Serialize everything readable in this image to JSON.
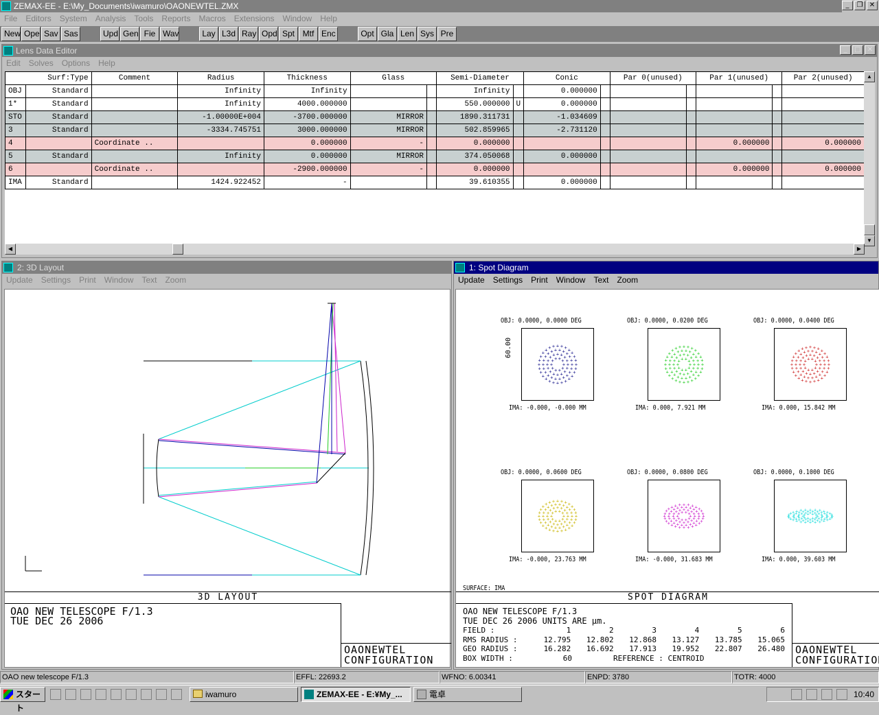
{
  "app": {
    "title": "ZEMAX-EE - E:\\My_Documents\\iwamuro\\OAONEWTEL.ZMX"
  },
  "menu": [
    "File",
    "Editors",
    "System",
    "Analysis",
    "Tools",
    "Reports",
    "Macros",
    "Extensions",
    "Window",
    "Help"
  ],
  "toolbar": {
    "group1": [
      "New",
      "Ope",
      "Sav",
      "Sas"
    ],
    "group2": [
      "Upd",
      "Gen",
      "Fie",
      "Wav"
    ],
    "group3": [
      "Lay",
      "L3d",
      "Ray",
      "Opd",
      "Spt",
      "Mtf",
      "Enc"
    ],
    "group4": [
      "Opt",
      "Gla",
      "Len",
      "Sys",
      "Pre"
    ]
  },
  "lde": {
    "title": "Lens Data Editor",
    "menu": [
      "Edit",
      "Solves",
      "Options",
      "Help"
    ],
    "columns": [
      "Surf:Type",
      "Comment",
      "Radius",
      "Thickness",
      "Glass",
      "Semi-Diameter",
      "Conic",
      "Par 0(unused)",
      "Par 1(unused)",
      "Par 2(unused)"
    ],
    "rows": [
      {
        "surf": "OBJ",
        "type": "Standard",
        "comment": "",
        "radius": "Infinity",
        "thickness": "Infinity",
        "glass": "",
        "sd": "Infinity",
        "sdflag": "",
        "conic": "0.000000",
        "p1": "",
        "p2": "",
        "style": ""
      },
      {
        "surf": "1*",
        "type": "Standard",
        "comment": "",
        "radius": "Infinity",
        "thickness": "4000.000000",
        "glass": "",
        "sd": "550.000000",
        "sdflag": "U",
        "conic": "0.000000",
        "p1": "",
        "p2": "",
        "style": ""
      },
      {
        "surf": "STO",
        "type": "Standard",
        "comment": "",
        "radius": "-1.00000E+004",
        "thickness": "-3700.000000",
        "glass": "MIRROR",
        "sd": "1890.311731",
        "sdflag": "",
        "conic": "-1.034609",
        "p1": "",
        "p2": "",
        "style": "gray"
      },
      {
        "surf": "3",
        "type": "Standard",
        "comment": "",
        "radius": "-3334.745751",
        "thickness": "3000.000000",
        "glass": "MIRROR",
        "sd": "502.859965",
        "sdflag": "",
        "conic": "-2.731120",
        "p1": "",
        "p2": "",
        "style": "gray"
      },
      {
        "surf": "4",
        "type": "",
        "comment": "Coordinate ..",
        "radius": "",
        "thickness": "0.000000",
        "glass": "-",
        "sd": "0.000000",
        "sdflag": "",
        "conic": "",
        "p1": "0.000000",
        "p2": "0.000000",
        "style": "pink"
      },
      {
        "surf": "5",
        "type": "Standard",
        "comment": "",
        "radius": "Infinity",
        "thickness": "0.000000",
        "glass": "MIRROR",
        "sd": "374.050068",
        "sdflag": "",
        "conic": "0.000000",
        "p1": "",
        "p2": "",
        "style": "gray"
      },
      {
        "surf": "6",
        "type": "",
        "comment": "Coordinate ..",
        "radius": "",
        "thickness": "-2900.000000",
        "glass": "-",
        "sd": "0.000000",
        "sdflag": "",
        "conic": "",
        "p1": "0.000000",
        "p2": "0.000000",
        "style": "pink"
      },
      {
        "surf": "IMA",
        "type": "Standard",
        "comment": "",
        "radius": "1424.922452",
        "thickness": "-",
        "glass": "",
        "sd": "39.610355",
        "sdflag": "",
        "conic": "0.000000",
        "p1": "",
        "p2": "",
        "style": ""
      }
    ]
  },
  "layout": {
    "title": "2: 3D Layout",
    "menu": [
      "Update",
      "Settings",
      "Print",
      "Window",
      "Text",
      "Zoom"
    ],
    "label": "3D LAYOUT",
    "footer_l1": "OAO NEW TELESCOPE F/1.3",
    "footer_l2": "TUE DEC 26 2006",
    "file": "OAONEWTEL",
    "config": "CONFIGURATION"
  },
  "spot": {
    "title": "1: Spot Diagram",
    "menu": [
      "Update",
      "Settings",
      "Print",
      "Window",
      "Text",
      "Zoom"
    ],
    "scale": "60.00",
    "surface": "SURFACE: IMA",
    "label": "SPOT DIAGRAM",
    "obj": [
      "OBJ: 0.0000, 0.0000 DEG",
      "OBJ: 0.0000, 0.0200 DEG",
      "OBJ: 0.0000, 0.0400 DEG",
      "OBJ: 0.0000, 0.0600 DEG",
      "OBJ: 0.0000, 0.0800 DEG",
      "OBJ: 0.0000, 0.1000 DEG"
    ],
    "ima": [
      "IMA: -0.000, -0.000 MM",
      "IMA: 0.000, 7.921 MM",
      "IMA: 0.000, 15.842 MM",
      "IMA: -0.000, 23.763 MM",
      "IMA: -0.000, 31.683 MM",
      "IMA: 0.000, 39.603 MM"
    ],
    "colors": [
      "#1a1a8c",
      "#22cc22",
      "#cc2222",
      "#c8b400",
      "#cc22cc",
      "#22dddd"
    ],
    "spot_shape": [
      {
        "rx": 1.0,
        "ry": 1.0
      },
      {
        "rx": 1.0,
        "ry": 0.96
      },
      {
        "rx": 1.0,
        "ry": 0.94
      },
      {
        "rx": 1.0,
        "ry": 0.82
      },
      {
        "rx": 1.05,
        "ry": 0.62
      },
      {
        "rx": 1.18,
        "ry": 0.34
      }
    ],
    "footer_l1": "OAO NEW TELESCOPE F/1.3",
    "footer_l2": "TUE DEC 26 2006  UNITS ARE µm.",
    "field_label": "FIELD    :",
    "fields": [
      "1",
      "2",
      "3",
      "4",
      "5",
      "6"
    ],
    "rms_label": "RMS RADIUS :",
    "rms": [
      "12.795",
      "12.802",
      "12.868",
      "13.127",
      "13.785",
      "15.065"
    ],
    "geo_label": "GEO RADIUS :",
    "geo": [
      "16.282",
      "16.692",
      "17.913",
      "19.952",
      "22.807",
      "26.480"
    ],
    "box_label": "BOX WIDTH  :",
    "box": "60",
    "reference": "REFERENCE  : CENTROID",
    "file": "OAONEWTEL",
    "config": "CONFIGURATION"
  },
  "status": [
    "OAO new telescope F/1.3",
    "EFFL: 22693.2",
    "WFNO: 6.00341",
    "ENPD: 3780",
    "TOTR: 4000"
  ],
  "taskbar": {
    "start": "スタート",
    "tasks": [
      "iwamuro",
      "ZEMAX-EE - E:¥My_...",
      "電卓"
    ],
    "clock": "10:40"
  }
}
